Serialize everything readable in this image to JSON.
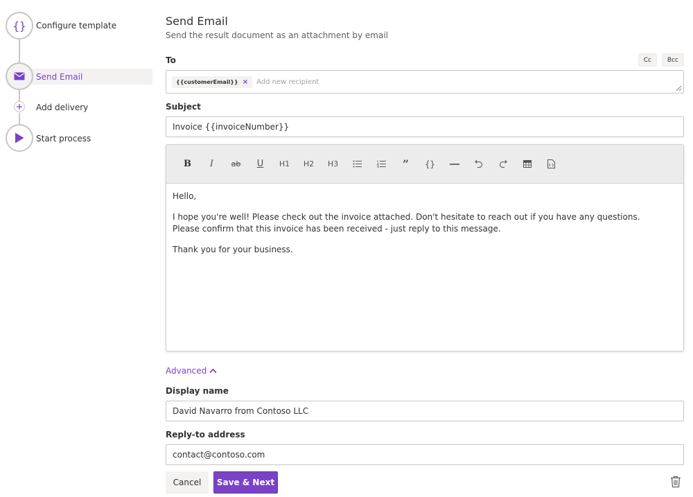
{
  "colors": {
    "accent": "#7a42c7",
    "border": "#c8c6c4",
    "muted": "#605e5c"
  },
  "stepper": {
    "steps": [
      {
        "label": "Configure template",
        "icon": "curly-braces-icon"
      },
      {
        "label": "Send Email",
        "icon": "envelope-icon",
        "active": true
      },
      {
        "label": "Add delivery",
        "icon": "plus-icon"
      },
      {
        "label": "Start process",
        "icon": "play-icon"
      }
    ]
  },
  "header": {
    "title": "Send Email",
    "subtitle": "Send the result document as an attachment by email"
  },
  "to": {
    "label": "To",
    "cc_label": "Cc",
    "bcc_label": "Bcc",
    "recipients": [
      "{{customerEmail}}"
    ],
    "placeholder": "Add new recipient"
  },
  "subject": {
    "label": "Subject",
    "value": "Invoice {{invoiceNumber}}"
  },
  "editor": {
    "toolbar": [
      {
        "label": "B",
        "icon": "bold-icon"
      },
      {
        "label": "I",
        "icon": "italic-icon"
      },
      {
        "label": "ab",
        "icon": "strikethrough-icon"
      },
      {
        "label": "U",
        "icon": "underline-icon"
      },
      {
        "label": "H1",
        "icon": "heading1-icon"
      },
      {
        "label": "H2",
        "icon": "heading2-icon"
      },
      {
        "label": "H3",
        "icon": "heading3-icon"
      },
      {
        "label": "",
        "icon": "bullet-list-icon"
      },
      {
        "label": "",
        "icon": "numbered-list-icon"
      },
      {
        "label": "”",
        "icon": "quote-icon"
      },
      {
        "label": "{}",
        "icon": "code-braces-icon"
      },
      {
        "label": "",
        "icon": "horizontal-rule-icon"
      },
      {
        "label": "",
        "icon": "undo-icon"
      },
      {
        "label": "",
        "icon": "redo-icon"
      },
      {
        "label": "",
        "icon": "table-icon"
      },
      {
        "label": "",
        "icon": "code-file-icon"
      }
    ],
    "body": {
      "greeting": "Hello,",
      "line1": "I hope you're well! Please check out the invoice attached. Don't hesitate to reach out if you have any questions.",
      "line2": "Please confirm that this invoice has been received - just reply to this message.",
      "closing": "Thank you for your business."
    }
  },
  "advanced": {
    "label": "Advanced",
    "display_name_label": "Display name",
    "display_name_value": "David Navarro from Contoso LLC",
    "reply_to_label": "Reply-to address",
    "reply_to_value": "contact@contoso.com"
  },
  "actions": {
    "cancel_label": "Cancel",
    "save_label": "Save & Next"
  }
}
